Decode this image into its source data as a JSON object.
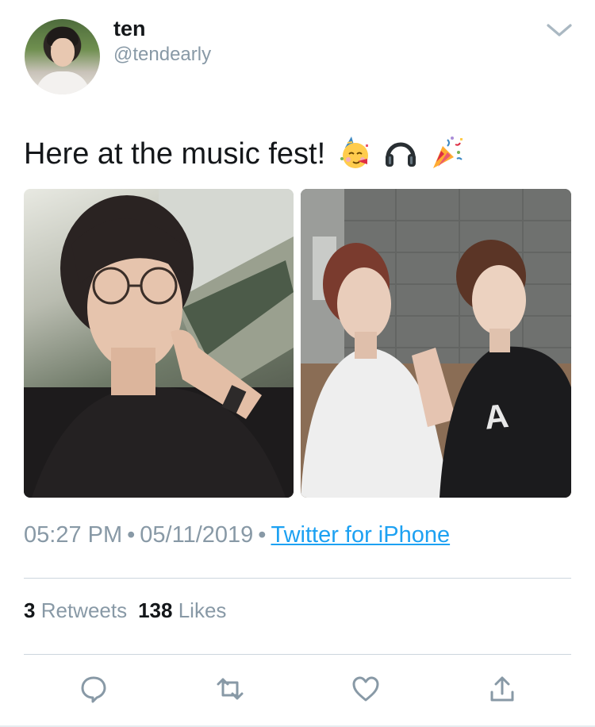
{
  "user": {
    "display_name": "ten",
    "handle": "@tendearly"
  },
  "tweet": {
    "text": "Here at the music fest!",
    "emojis": [
      "partying-face-emoji",
      "headphones-emoji",
      "party-popper-emoji"
    ],
    "time": "05:27 PM",
    "date": "05/11/2019",
    "separator": "•",
    "source": "Twitter for iPhone"
  },
  "stats": {
    "retweets_count": "3",
    "retweets_label": "Retweets",
    "likes_count": "138",
    "likes_label": "Likes"
  },
  "actions": [
    "reply-icon",
    "retweet-icon",
    "like-icon",
    "share-icon"
  ],
  "colors": {
    "link": "#1da1f2",
    "secondary_text": "#8899a6",
    "primary_text": "#14171a",
    "divider": "#ccd6dd"
  }
}
